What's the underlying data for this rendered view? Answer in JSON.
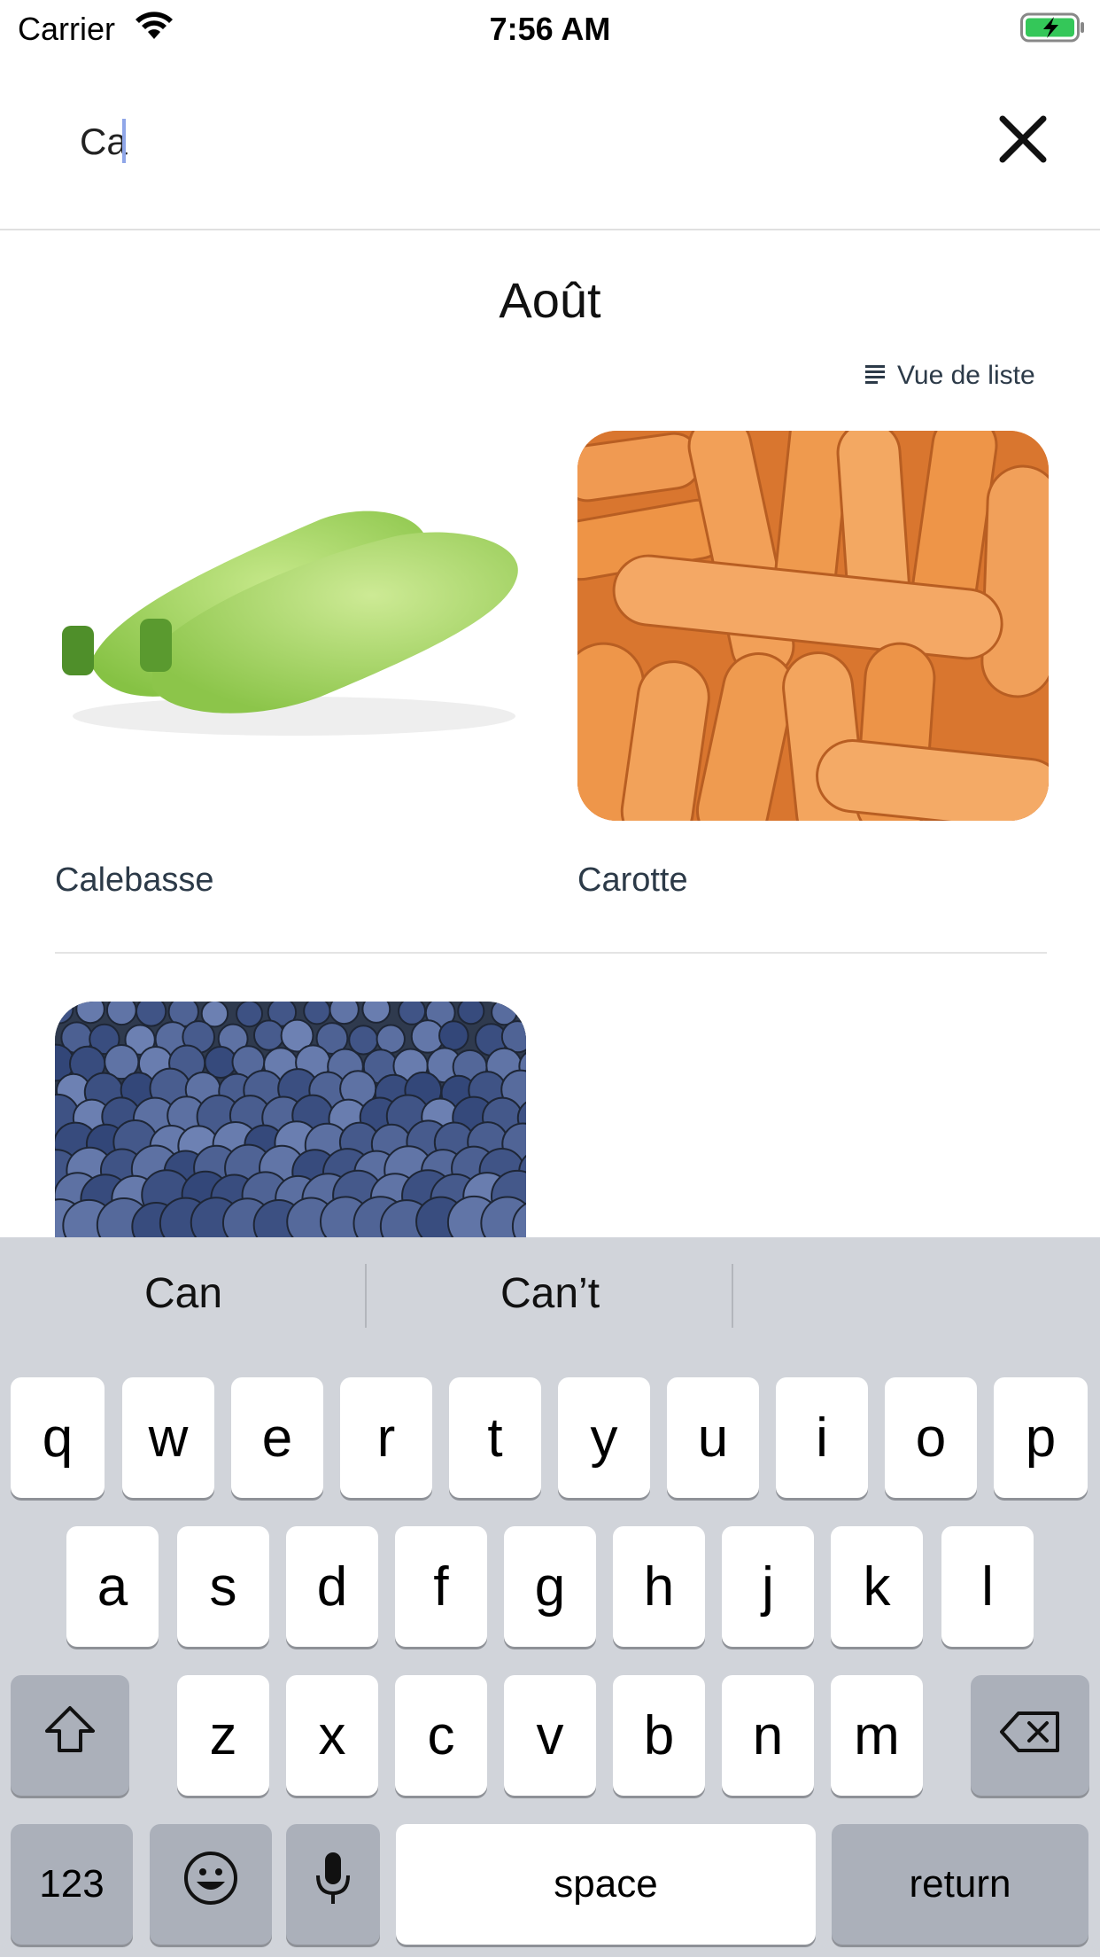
{
  "status_bar": {
    "carrier": "Carrier",
    "time": "7:56 AM",
    "wifi_icon": "wifi-icon",
    "battery_icon": "battery-charging-icon",
    "battery_color": "#34c759"
  },
  "search": {
    "value": "Ca",
    "close_icon": "close-icon"
  },
  "main": {
    "month_title": "Août",
    "view_toggle": {
      "icon": "list-view-icon",
      "label": "Vue de liste"
    },
    "items": [
      {
        "name": "Calebasse",
        "image": "green-squash"
      },
      {
        "name": "Carotte",
        "image": "carrots"
      },
      {
        "name": "",
        "image": "blueberries"
      }
    ]
  },
  "keyboard": {
    "suggestions": [
      "Can",
      "Can’t",
      ""
    ],
    "row1": [
      "q",
      "w",
      "e",
      "r",
      "t",
      "y",
      "u",
      "i",
      "o",
      "p"
    ],
    "row2": [
      "a",
      "s",
      "d",
      "f",
      "g",
      "h",
      "j",
      "k",
      "l"
    ],
    "row3": [
      "z",
      "x",
      "c",
      "v",
      "b",
      "n",
      "m"
    ],
    "shift_icon": "shift-icon",
    "backspace_icon": "backspace-icon",
    "numbers_label": "123",
    "emoji_icon": "emoji-icon",
    "mic_icon": "microphone-icon",
    "space_label": "space",
    "return_label": "return"
  }
}
